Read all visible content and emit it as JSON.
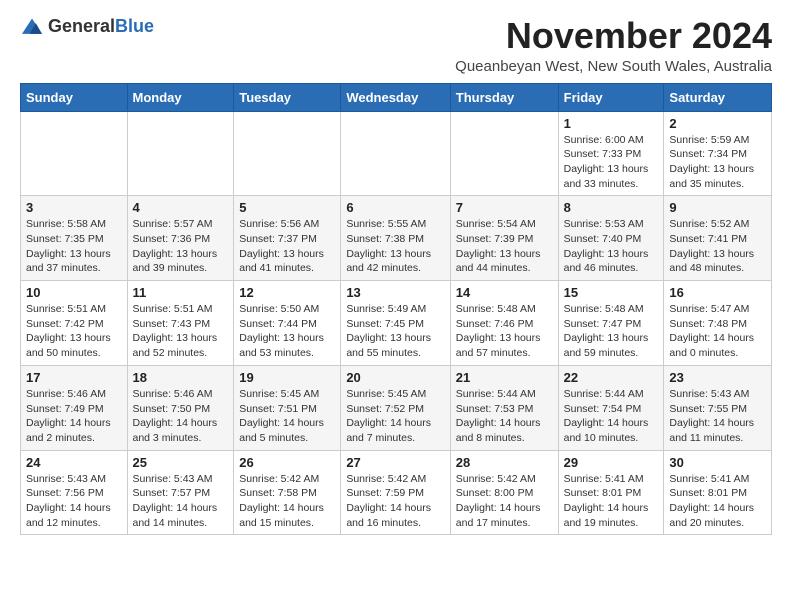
{
  "logo": {
    "text_general": "General",
    "text_blue": "Blue"
  },
  "header": {
    "month_title": "November 2024",
    "location": "Queanbeyan West, New South Wales, Australia"
  },
  "weekdays": [
    "Sunday",
    "Monday",
    "Tuesday",
    "Wednesday",
    "Thursday",
    "Friday",
    "Saturday"
  ],
  "weeks": [
    [
      {
        "day": "",
        "info": ""
      },
      {
        "day": "",
        "info": ""
      },
      {
        "day": "",
        "info": ""
      },
      {
        "day": "",
        "info": ""
      },
      {
        "day": "",
        "info": ""
      },
      {
        "day": "1",
        "info": "Sunrise: 6:00 AM\nSunset: 7:33 PM\nDaylight: 13 hours\nand 33 minutes."
      },
      {
        "day": "2",
        "info": "Sunrise: 5:59 AM\nSunset: 7:34 PM\nDaylight: 13 hours\nand 35 minutes."
      }
    ],
    [
      {
        "day": "3",
        "info": "Sunrise: 5:58 AM\nSunset: 7:35 PM\nDaylight: 13 hours\nand 37 minutes."
      },
      {
        "day": "4",
        "info": "Sunrise: 5:57 AM\nSunset: 7:36 PM\nDaylight: 13 hours\nand 39 minutes."
      },
      {
        "day": "5",
        "info": "Sunrise: 5:56 AM\nSunset: 7:37 PM\nDaylight: 13 hours\nand 41 minutes."
      },
      {
        "day": "6",
        "info": "Sunrise: 5:55 AM\nSunset: 7:38 PM\nDaylight: 13 hours\nand 42 minutes."
      },
      {
        "day": "7",
        "info": "Sunrise: 5:54 AM\nSunset: 7:39 PM\nDaylight: 13 hours\nand 44 minutes."
      },
      {
        "day": "8",
        "info": "Sunrise: 5:53 AM\nSunset: 7:40 PM\nDaylight: 13 hours\nand 46 minutes."
      },
      {
        "day": "9",
        "info": "Sunrise: 5:52 AM\nSunset: 7:41 PM\nDaylight: 13 hours\nand 48 minutes."
      }
    ],
    [
      {
        "day": "10",
        "info": "Sunrise: 5:51 AM\nSunset: 7:42 PM\nDaylight: 13 hours\nand 50 minutes."
      },
      {
        "day": "11",
        "info": "Sunrise: 5:51 AM\nSunset: 7:43 PM\nDaylight: 13 hours\nand 52 minutes."
      },
      {
        "day": "12",
        "info": "Sunrise: 5:50 AM\nSunset: 7:44 PM\nDaylight: 13 hours\nand 53 minutes."
      },
      {
        "day": "13",
        "info": "Sunrise: 5:49 AM\nSunset: 7:45 PM\nDaylight: 13 hours\nand 55 minutes."
      },
      {
        "day": "14",
        "info": "Sunrise: 5:48 AM\nSunset: 7:46 PM\nDaylight: 13 hours\nand 57 minutes."
      },
      {
        "day": "15",
        "info": "Sunrise: 5:48 AM\nSunset: 7:47 PM\nDaylight: 13 hours\nand 59 minutes."
      },
      {
        "day": "16",
        "info": "Sunrise: 5:47 AM\nSunset: 7:48 PM\nDaylight: 14 hours\nand 0 minutes."
      }
    ],
    [
      {
        "day": "17",
        "info": "Sunrise: 5:46 AM\nSunset: 7:49 PM\nDaylight: 14 hours\nand 2 minutes."
      },
      {
        "day": "18",
        "info": "Sunrise: 5:46 AM\nSunset: 7:50 PM\nDaylight: 14 hours\nand 3 minutes."
      },
      {
        "day": "19",
        "info": "Sunrise: 5:45 AM\nSunset: 7:51 PM\nDaylight: 14 hours\nand 5 minutes."
      },
      {
        "day": "20",
        "info": "Sunrise: 5:45 AM\nSunset: 7:52 PM\nDaylight: 14 hours\nand 7 minutes."
      },
      {
        "day": "21",
        "info": "Sunrise: 5:44 AM\nSunset: 7:53 PM\nDaylight: 14 hours\nand 8 minutes."
      },
      {
        "day": "22",
        "info": "Sunrise: 5:44 AM\nSunset: 7:54 PM\nDaylight: 14 hours\nand 10 minutes."
      },
      {
        "day": "23",
        "info": "Sunrise: 5:43 AM\nSunset: 7:55 PM\nDaylight: 14 hours\nand 11 minutes."
      }
    ],
    [
      {
        "day": "24",
        "info": "Sunrise: 5:43 AM\nSunset: 7:56 PM\nDaylight: 14 hours\nand 12 minutes."
      },
      {
        "day": "25",
        "info": "Sunrise: 5:43 AM\nSunset: 7:57 PM\nDaylight: 14 hours\nand 14 minutes."
      },
      {
        "day": "26",
        "info": "Sunrise: 5:42 AM\nSunset: 7:58 PM\nDaylight: 14 hours\nand 15 minutes."
      },
      {
        "day": "27",
        "info": "Sunrise: 5:42 AM\nSunset: 7:59 PM\nDaylight: 14 hours\nand 16 minutes."
      },
      {
        "day": "28",
        "info": "Sunrise: 5:42 AM\nSunset: 8:00 PM\nDaylight: 14 hours\nand 17 minutes."
      },
      {
        "day": "29",
        "info": "Sunrise: 5:41 AM\nSunset: 8:01 PM\nDaylight: 14 hours\nand 19 minutes."
      },
      {
        "day": "30",
        "info": "Sunrise: 5:41 AM\nSunset: 8:01 PM\nDaylight: 14 hours\nand 20 minutes."
      }
    ]
  ]
}
